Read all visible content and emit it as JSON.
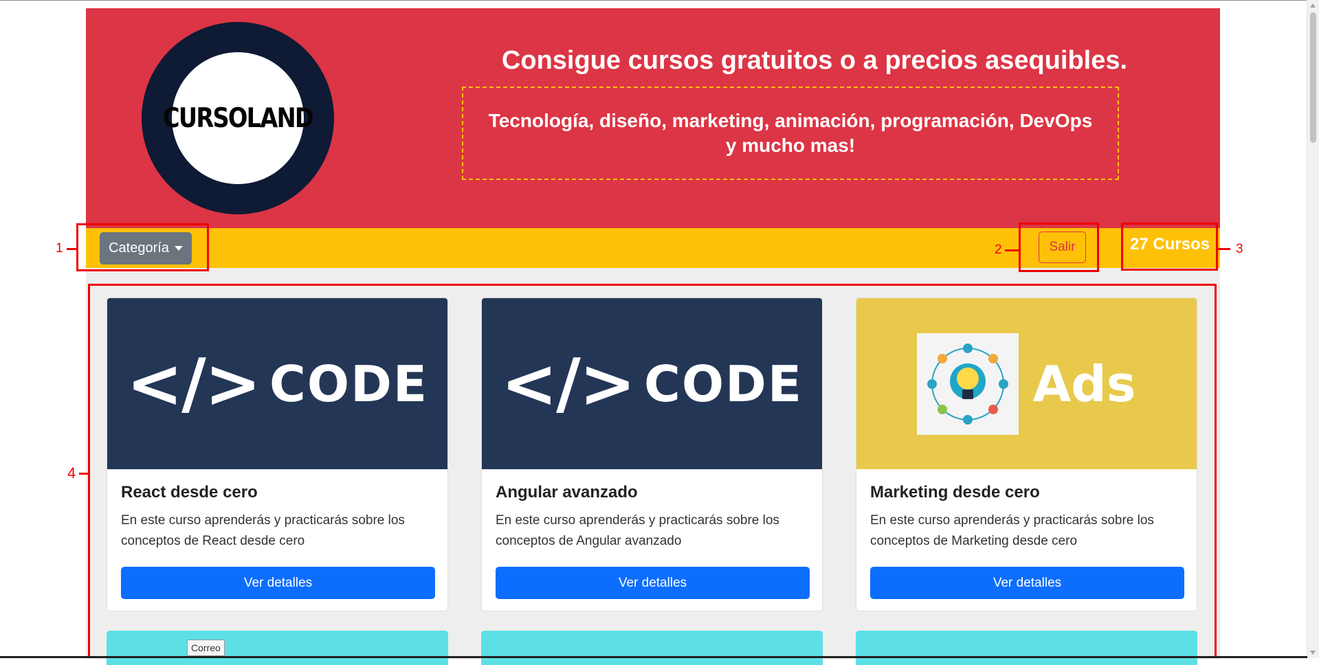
{
  "hero": {
    "logo_text": "CURSOLAND",
    "title": "Consigue cursos gratuitos o a precios asequibles.",
    "subtitle_line1": "Tecnología, diseño, marketing, animación, programación, DevOps",
    "subtitle_line2": "y mucho mas!"
  },
  "navbar": {
    "category_label": "Categoría",
    "logout_label": "Salir",
    "course_count": "27 Cursos"
  },
  "courses": [
    {
      "image_icon": "code-image",
      "image_tag": "</>",
      "image_word": "CODE",
      "title": "React desde cero",
      "description": "En este curso aprenderás y practicarás sobre los conceptos de React desde cero",
      "button": "Ver detalles"
    },
    {
      "image_icon": "code-image",
      "image_tag": "</>",
      "image_word": "CODE",
      "title": "Angular avanzado",
      "description": "En este curso aprenderás y practicarás sobre los conceptos de Angular avanzado",
      "button": "Ver detalles"
    },
    {
      "image_icon": "ads-image",
      "image_word": "Ads",
      "title": "Marketing desde cero",
      "description": "En este curso aprenderás y practicarás sobre los conceptos de Marketing desde cero",
      "button": "Ver detalles"
    }
  ],
  "tooltip": "Correo",
  "annotations": [
    "1",
    "2",
    "3",
    "4"
  ],
  "colors": {
    "hero_bg": "#dc3545",
    "navbar_bg": "#ffc107",
    "primary_button": "#0d6efd",
    "secondary_button": "#6c757d",
    "annotation": "#ee0000",
    "code_bg": "#233656",
    "ads_bg": "#e8c94b",
    "next_row_cards": "#5ce0e6"
  }
}
